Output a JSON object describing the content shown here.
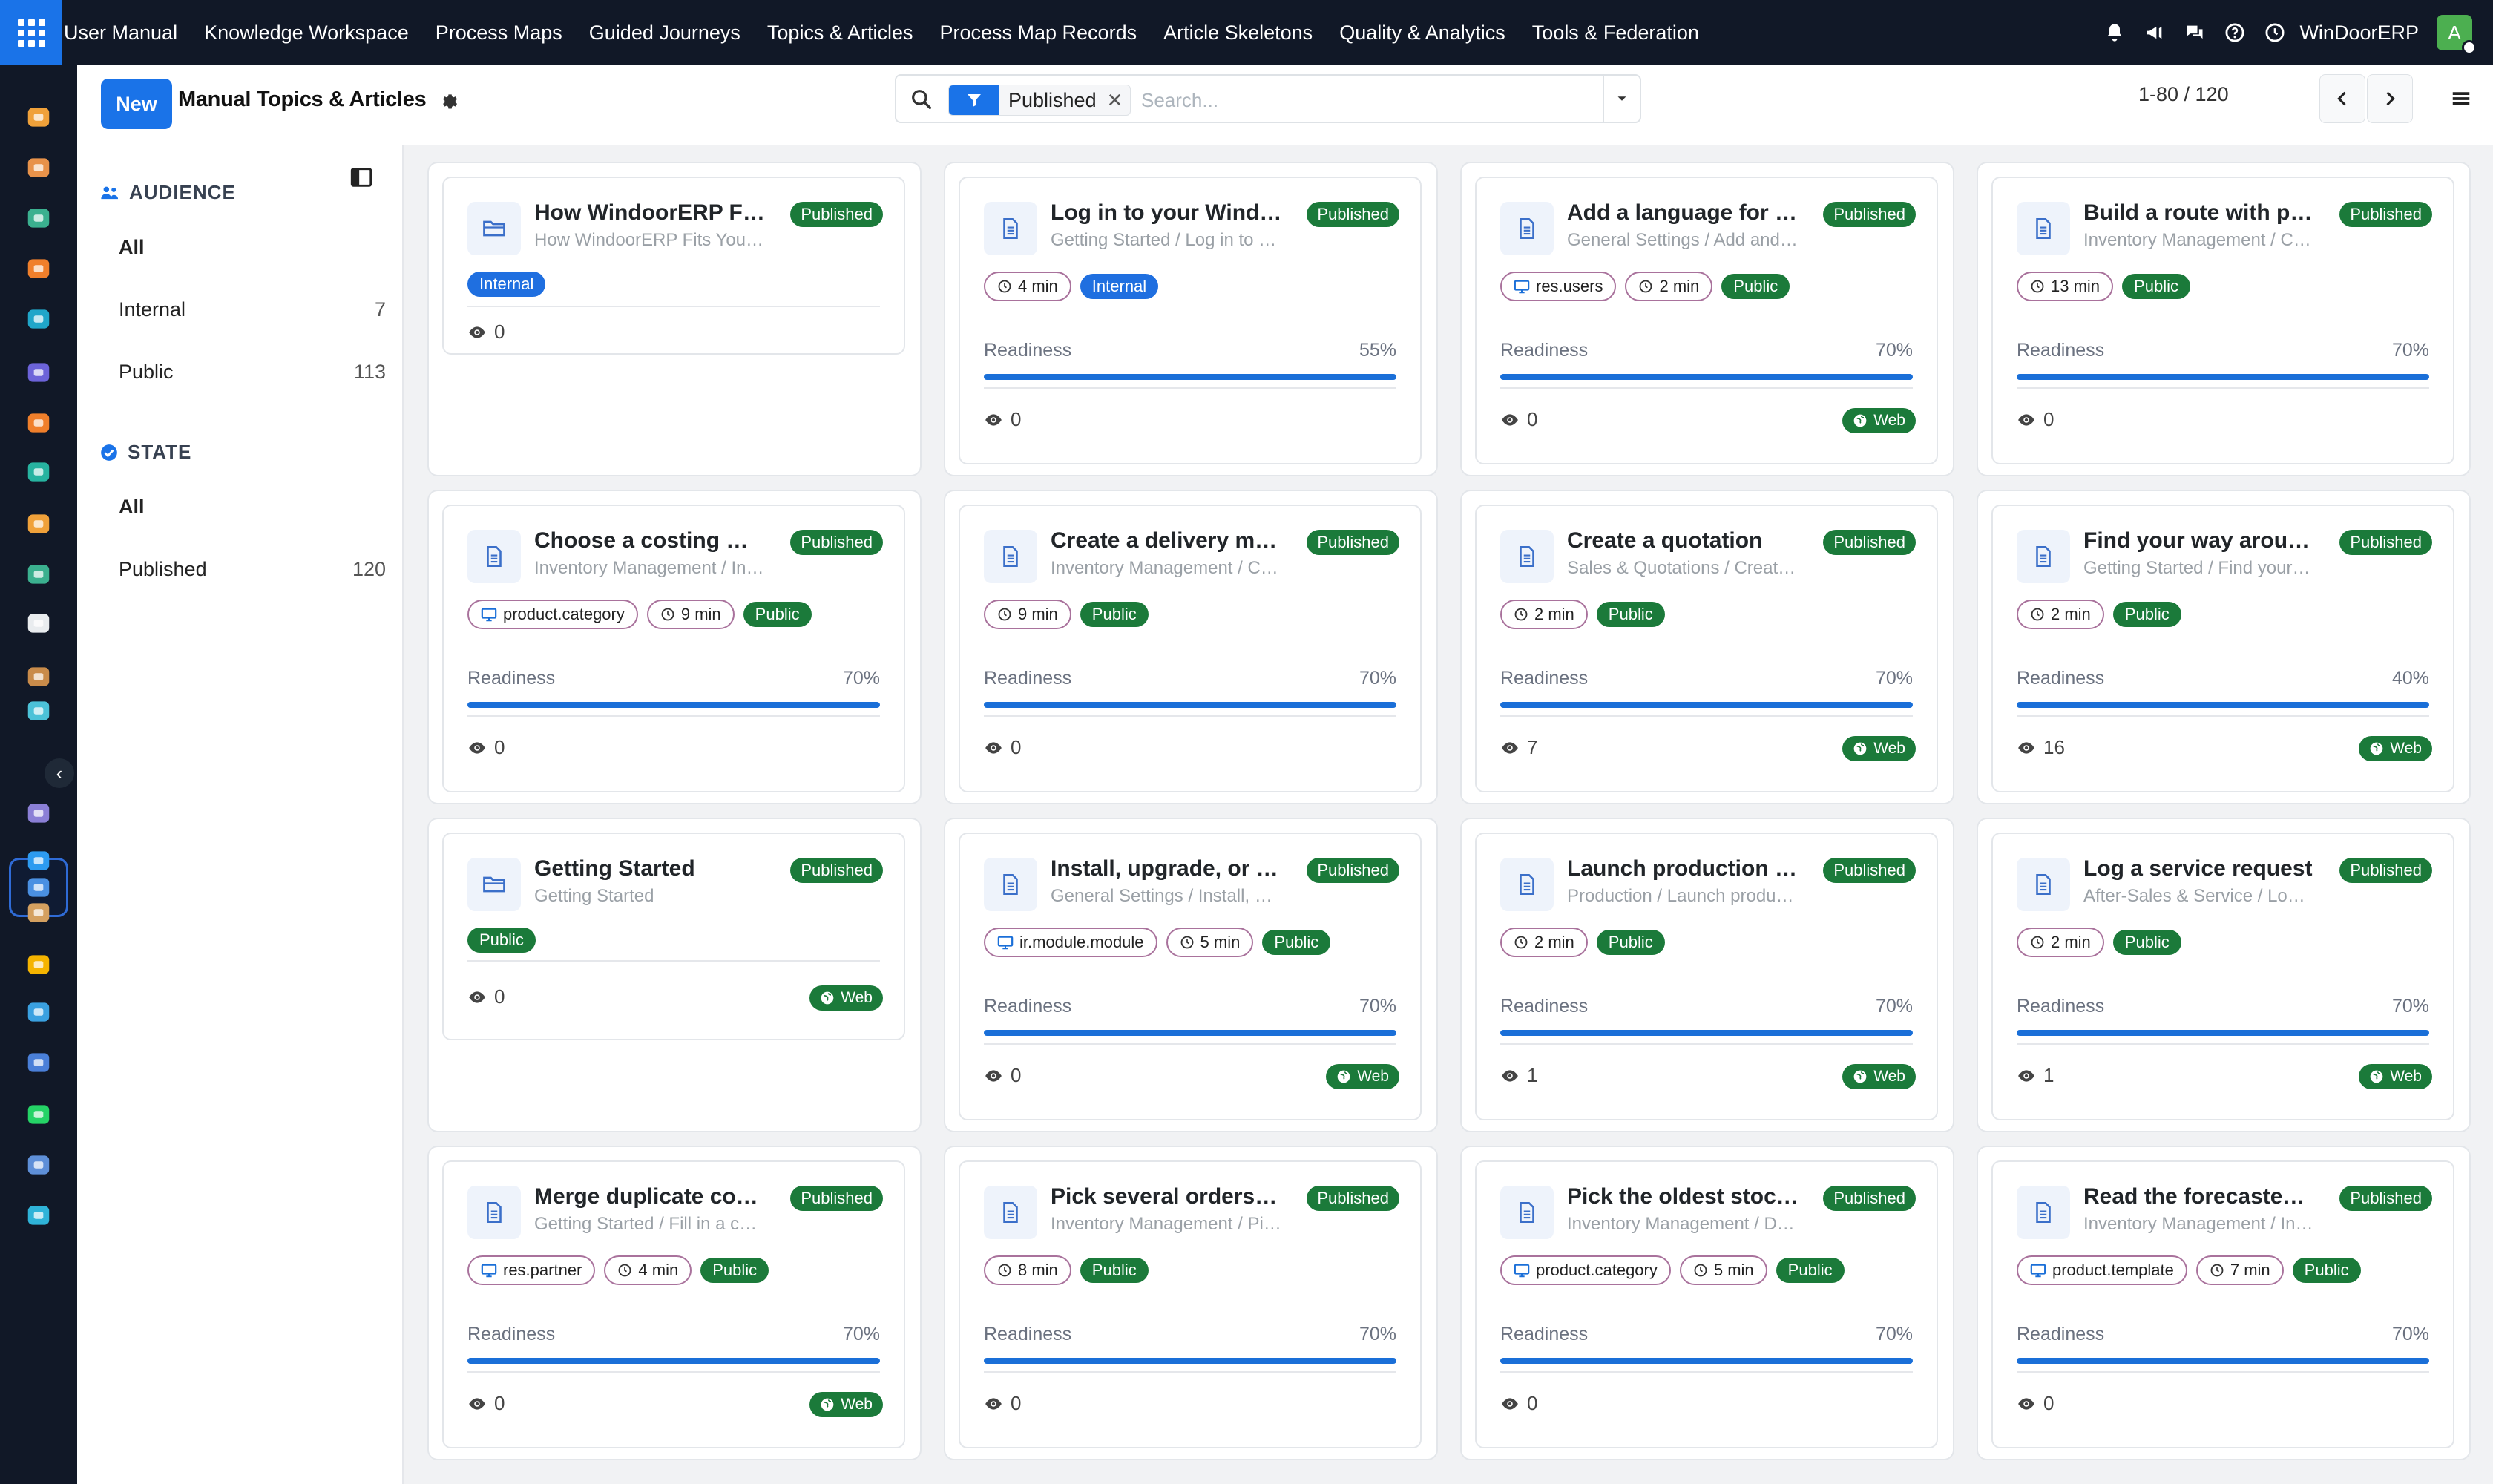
{
  "topnav": {
    "items": [
      "User Manual",
      "Knowledge Workspace",
      "Process Maps",
      "Guided Journeys",
      "Topics & Articles",
      "Process Map Records",
      "Article Skeletons",
      "Quality & Analytics",
      "Tools & Federation"
    ],
    "company": "WinDoorERP",
    "avatar_letter": "A"
  },
  "control": {
    "new_label": "New",
    "title": "Manual Topics & Articles",
    "facet_label": "Published",
    "search_placeholder": "Search...",
    "pager": "1-80 / 120"
  },
  "searchpanel": {
    "audience_label": "AUDIENCE",
    "audience_items": [
      {
        "label": "All",
        "count": ""
      },
      {
        "label": "Internal",
        "count": "7"
      },
      {
        "label": "Public",
        "count": "113"
      }
    ],
    "state_label": "STATE",
    "state_items": [
      {
        "label": "All",
        "count": ""
      },
      {
        "label": "Published",
        "count": "120"
      }
    ]
  },
  "cards": [
    [
      {
        "title": "How WindoorERP Fi…",
        "subtitle": "How WindoorERP Fits Your…",
        "status": "Published",
        "icon": "folder-icon",
        "model": "",
        "time": "",
        "audience": "Internal",
        "readiness": null,
        "views": "0",
        "web": false
      },
      {
        "title": "Choose a costing m…",
        "subtitle": "Inventory Management / In…",
        "status": "Published",
        "icon": "document-icon",
        "model": "product.category",
        "time": "9 min",
        "audience": "Public",
        "readiness": 0.7,
        "readiness_label": "70%",
        "views": "0",
        "web": false
      },
      {
        "title": "Getting Started",
        "subtitle": "Getting Started",
        "status": "Published",
        "icon": "folder-icon",
        "model": "",
        "time": "",
        "audience": "Public",
        "readiness": null,
        "views": "0",
        "web": true
      },
      {
        "title": "Merge duplicate co…",
        "subtitle": "Getting Started / Fill in a c…",
        "status": "Published",
        "icon": "document-icon",
        "model": "res.partner",
        "time": "4 min",
        "audience": "Public",
        "readiness": 0.7,
        "readiness_label": "70%",
        "views": "0",
        "web": true
      }
    ],
    [
      {
        "title": "Log in to your Wind…",
        "subtitle": "Getting Started / Log in to …",
        "status": "Published",
        "icon": "document-icon",
        "model": "",
        "time": "4 min",
        "audience": "Internal",
        "readiness": 0.55,
        "readiness_label": "55%",
        "views": "0",
        "web": false
      },
      {
        "title": "Create a delivery m…",
        "subtitle": "Inventory Management / C…",
        "status": "Published",
        "icon": "document-icon",
        "model": "",
        "time": "9 min",
        "audience": "Public",
        "readiness": 0.7,
        "readiness_label": "70%",
        "views": "0",
        "web": false
      },
      {
        "title": "Install, upgrade, or r…",
        "subtitle": "General Settings / Install, u…",
        "status": "Published",
        "icon": "document-icon",
        "model": "ir.module.module",
        "time": "5 min",
        "audience": "Public",
        "readiness": 0.7,
        "readiness_label": "70%",
        "views": "0",
        "web": true
      },
      {
        "title": "Pick several orders …",
        "subtitle": "Inventory Management / Pi…",
        "status": "Published",
        "icon": "document-icon",
        "model": "",
        "time": "8 min",
        "audience": "Public",
        "readiness": 0.7,
        "readiness_label": "70%",
        "views": "0",
        "web": false
      }
    ],
    [
      {
        "title": "Add a language for …",
        "subtitle": "General Settings / Add and…",
        "status": "Published",
        "icon": "document-icon",
        "model": "res.users",
        "time": "2 min",
        "audience": "Public",
        "readiness": 0.7,
        "readiness_label": "70%",
        "views": "0",
        "web": true
      },
      {
        "title": "Create a quotation",
        "subtitle": "Sales & Quotations / Creat…",
        "status": "Published",
        "icon": "document-icon",
        "model": "",
        "time": "2 min",
        "audience": "Public",
        "readiness": 0.7,
        "readiness_label": "70%",
        "views": "7",
        "web": true
      },
      {
        "title": "Launch production f…",
        "subtitle": "Production / Launch produ…",
        "status": "Published",
        "icon": "document-icon",
        "model": "",
        "time": "2 min",
        "audience": "Public",
        "readiness": 0.7,
        "readiness_label": "70%",
        "views": "1",
        "web": true
      },
      {
        "title": "Pick the oldest stoc…",
        "subtitle": "Inventory Management / D…",
        "status": "Published",
        "icon": "document-icon",
        "model": "product.category",
        "time": "5 min",
        "audience": "Public",
        "readiness": 0.7,
        "readiness_label": "70%",
        "views": "0",
        "web": false
      }
    ],
    [
      {
        "title": "Build a route with pu…",
        "subtitle": "Inventory Management / C…",
        "status": "Published",
        "icon": "document-icon",
        "model": "",
        "time": "13 min",
        "audience": "Public",
        "readiness": 0.7,
        "readiness_label": "70%",
        "views": "0",
        "web": false
      },
      {
        "title": "Find your way arou…",
        "subtitle": "Getting Started / Find your …",
        "status": "Published",
        "icon": "document-icon",
        "model": "",
        "time": "2 min",
        "audience": "Public",
        "readiness": 0.4,
        "readiness_label": "40%",
        "views": "16",
        "web": true
      },
      {
        "title": "Log a service request",
        "subtitle": "After-Sales & Service / Log…",
        "status": "Published",
        "icon": "document-icon",
        "model": "",
        "time": "2 min",
        "audience": "Public",
        "readiness": 0.7,
        "readiness_label": "70%",
        "views": "1",
        "web": true
      },
      {
        "title": "Read the forecaste…",
        "subtitle": "Inventory Management / In…",
        "status": "Published",
        "icon": "document-icon",
        "model": "product.template",
        "time": "7 min",
        "audience": "Public",
        "readiness": 0.7,
        "readiness_label": "70%",
        "views": "0",
        "web": false
      }
    ]
  ],
  "labels": {
    "readiness": "Readiness",
    "web": "Web"
  },
  "colors": {
    "brand": "#1a73e8",
    "published": "#1b7a3a",
    "internal": "#1f6fe0",
    "topbar": "#111827"
  },
  "dock_icons": [
    "dashboard-app-icon",
    "photo-app-icon",
    "contacts-app-icon",
    "discuss-app-icon",
    "web-app-icon",
    "mail-app-icon",
    "livechat-app-icon",
    "forms-app-icon",
    "reporting-app-icon",
    "employees-app-icon",
    "inventory-app-icon",
    "planning-app-icon",
    "project-app-icon",
    "knowledge-app-icon",
    "product-app-icon",
    "invoicing-app-icon",
    "team-app-icon",
    "calendar-app-icon",
    "sign-app-icon",
    "dashboard2-app-icon",
    "whatsapp-app-icon",
    "clock-app-icon",
    "website-app-icon"
  ]
}
